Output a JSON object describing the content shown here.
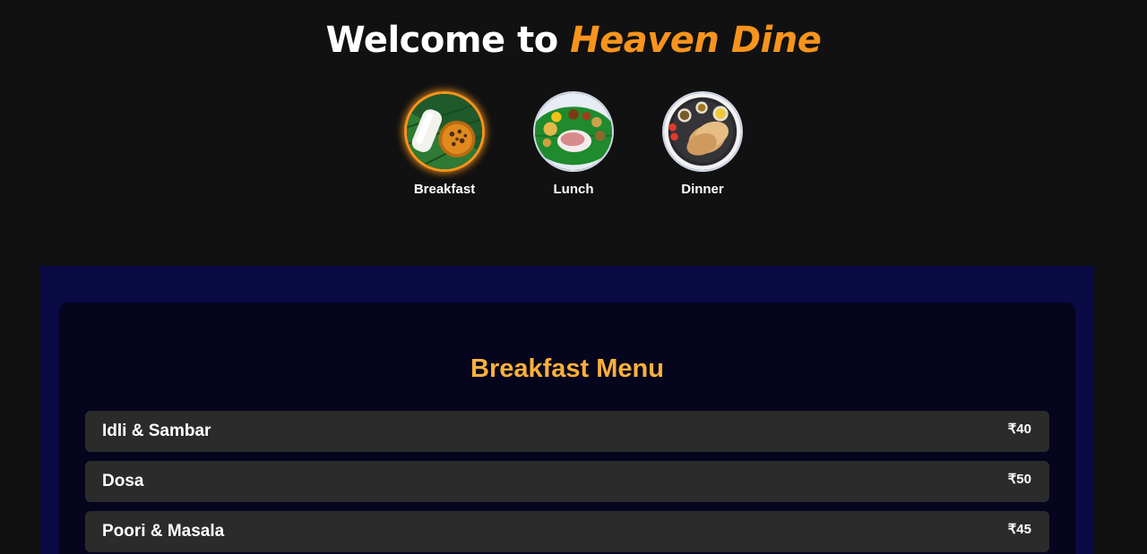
{
  "header": {
    "title_prefix": "Welcome to ",
    "title_brand": "Heaven Dine",
    "brand_color": "#f7941d"
  },
  "categories": [
    {
      "label": "Breakfast",
      "icon": "idli-sambar-plate-icon",
      "active": true
    },
    {
      "label": "Lunch",
      "icon": "banana-leaf-meal-icon",
      "active": false
    },
    {
      "label": "Dinner",
      "icon": "roti-plate-icon",
      "active": false
    }
  ],
  "menu": {
    "title": "Breakfast Menu",
    "title_color": "#fbb03b",
    "items": [
      {
        "name": "Idli & Sambar",
        "price": "₹40"
      },
      {
        "name": "Dosa",
        "price": "₹50"
      },
      {
        "name": "Poori & Masala",
        "price": "₹45"
      }
    ]
  }
}
